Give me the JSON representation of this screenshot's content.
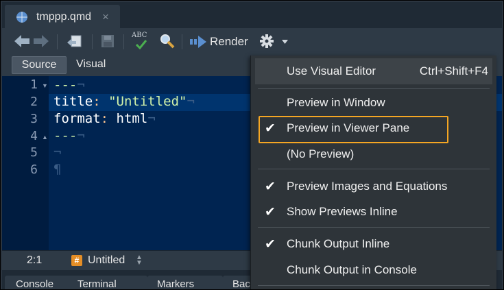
{
  "tab": {
    "title": "tmppp.qmd",
    "close_glyph": "×"
  },
  "toolbar": {
    "render_label": "Render",
    "spellcheck_label": "ABC"
  },
  "modes": {
    "source": "Source",
    "visual": "Visual"
  },
  "editor": {
    "line_numbers": [
      "1",
      "2",
      "3",
      "4",
      "5",
      "6"
    ],
    "lines": {
      "l1_dashes": "---",
      "l2_key": "title",
      "l2_colon": ":",
      "l2_value": "\"Untitled\"",
      "l3_key": "format",
      "l3_colon": ":",
      "l3_value": "html",
      "l4_dashes": "---",
      "ws_mark": "¬",
      "para_mark": "¶"
    }
  },
  "status": {
    "position": "2:1",
    "badge": "#",
    "outline": "Untitled"
  },
  "bottom_tabs": [
    "Console",
    "Terminal",
    "Markers",
    "Background Jobs"
  ],
  "menu": {
    "use_visual_editor": "Use Visual Editor",
    "use_visual_editor_shortcut": "Ctrl+Shift+F4",
    "preview_in_window": "Preview in Window",
    "preview_in_viewer_pane": "Preview in Viewer Pane",
    "no_preview": "(No Preview)",
    "preview_images_equations": "Preview Images and Equations",
    "show_previews_inline": "Show Previews Inline",
    "chunk_output_inline": "Chunk Output Inline",
    "chunk_output_console": "Chunk Output in Console",
    "check_glyph": "✔"
  },
  "colors": {
    "highlight": "#f5a623",
    "editor_bg": "#002451",
    "menu_bg": "#2e3439"
  }
}
